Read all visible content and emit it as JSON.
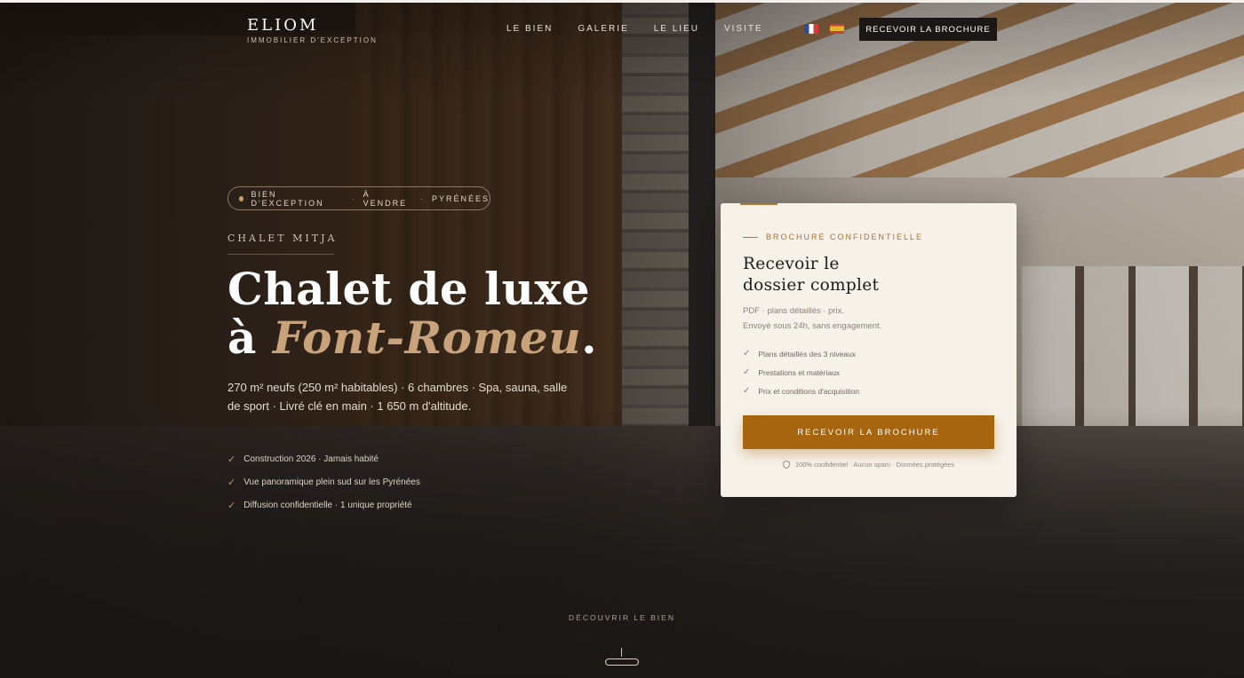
{
  "brand": {
    "name": "ELIOM",
    "tagline": "IMMOBILIER D'EXCEPTION"
  },
  "nav": {
    "items": [
      "LE BIEN",
      "GALERIE",
      "LE LIEU",
      "VISITE"
    ]
  },
  "languages": [
    {
      "code": "fr",
      "icon": "flag-fr-icon"
    },
    {
      "code": "es",
      "icon": "flag-es-icon"
    }
  ],
  "header_cta": "RECEVOIR LA BROCHURE",
  "hero": {
    "pill": [
      "BIEN D'EXCEPTION",
      "À VENDRE",
      "PYRÉNÉES"
    ],
    "pill_sep": "·",
    "kicker": "CHALET MITJA",
    "title_line1": "Chalet de luxe",
    "title_line2_prefix": "à ",
    "title_line2_accent": "Font-Romeu",
    "title_line2_suffix": ".",
    "lead": "270 m² neufs (250 m² habitables) · 6 chambres · Spa, sauna, salle de sport · Livré clé en main · 1 650 m d'altitude.",
    "features": [
      "Construction 2026 · Jamais habité",
      "Vue panoramique plein sud sur les Pyrénées",
      "Diffusion confidentielle · 1 unique propriété"
    ]
  },
  "card": {
    "eyebrow": "BROCHURE CONFIDENTIELLE",
    "title_line1": "Recevoir le",
    "title_line2": "dossier complet",
    "sub_line1": "PDF · plans détaillés · prix.",
    "sub_line2": "Envoyé sous 24h, sans engagement.",
    "items": [
      "Plans détaillés des 3 niveaux",
      "Prestations et matériaux",
      "Prix et conditions d'acquisition"
    ],
    "button": "RECEVOIR LA BROCHURE",
    "privacy": "100% confidentiel · Aucun spam · Données protégées"
  },
  "discover": "DÉCOUVRIR LE BIEN",
  "colors": {
    "accent": "#a8650f",
    "gold": "#c8a27a",
    "card_bg": "#f6f2ea",
    "dark_button": "#1a1714"
  }
}
